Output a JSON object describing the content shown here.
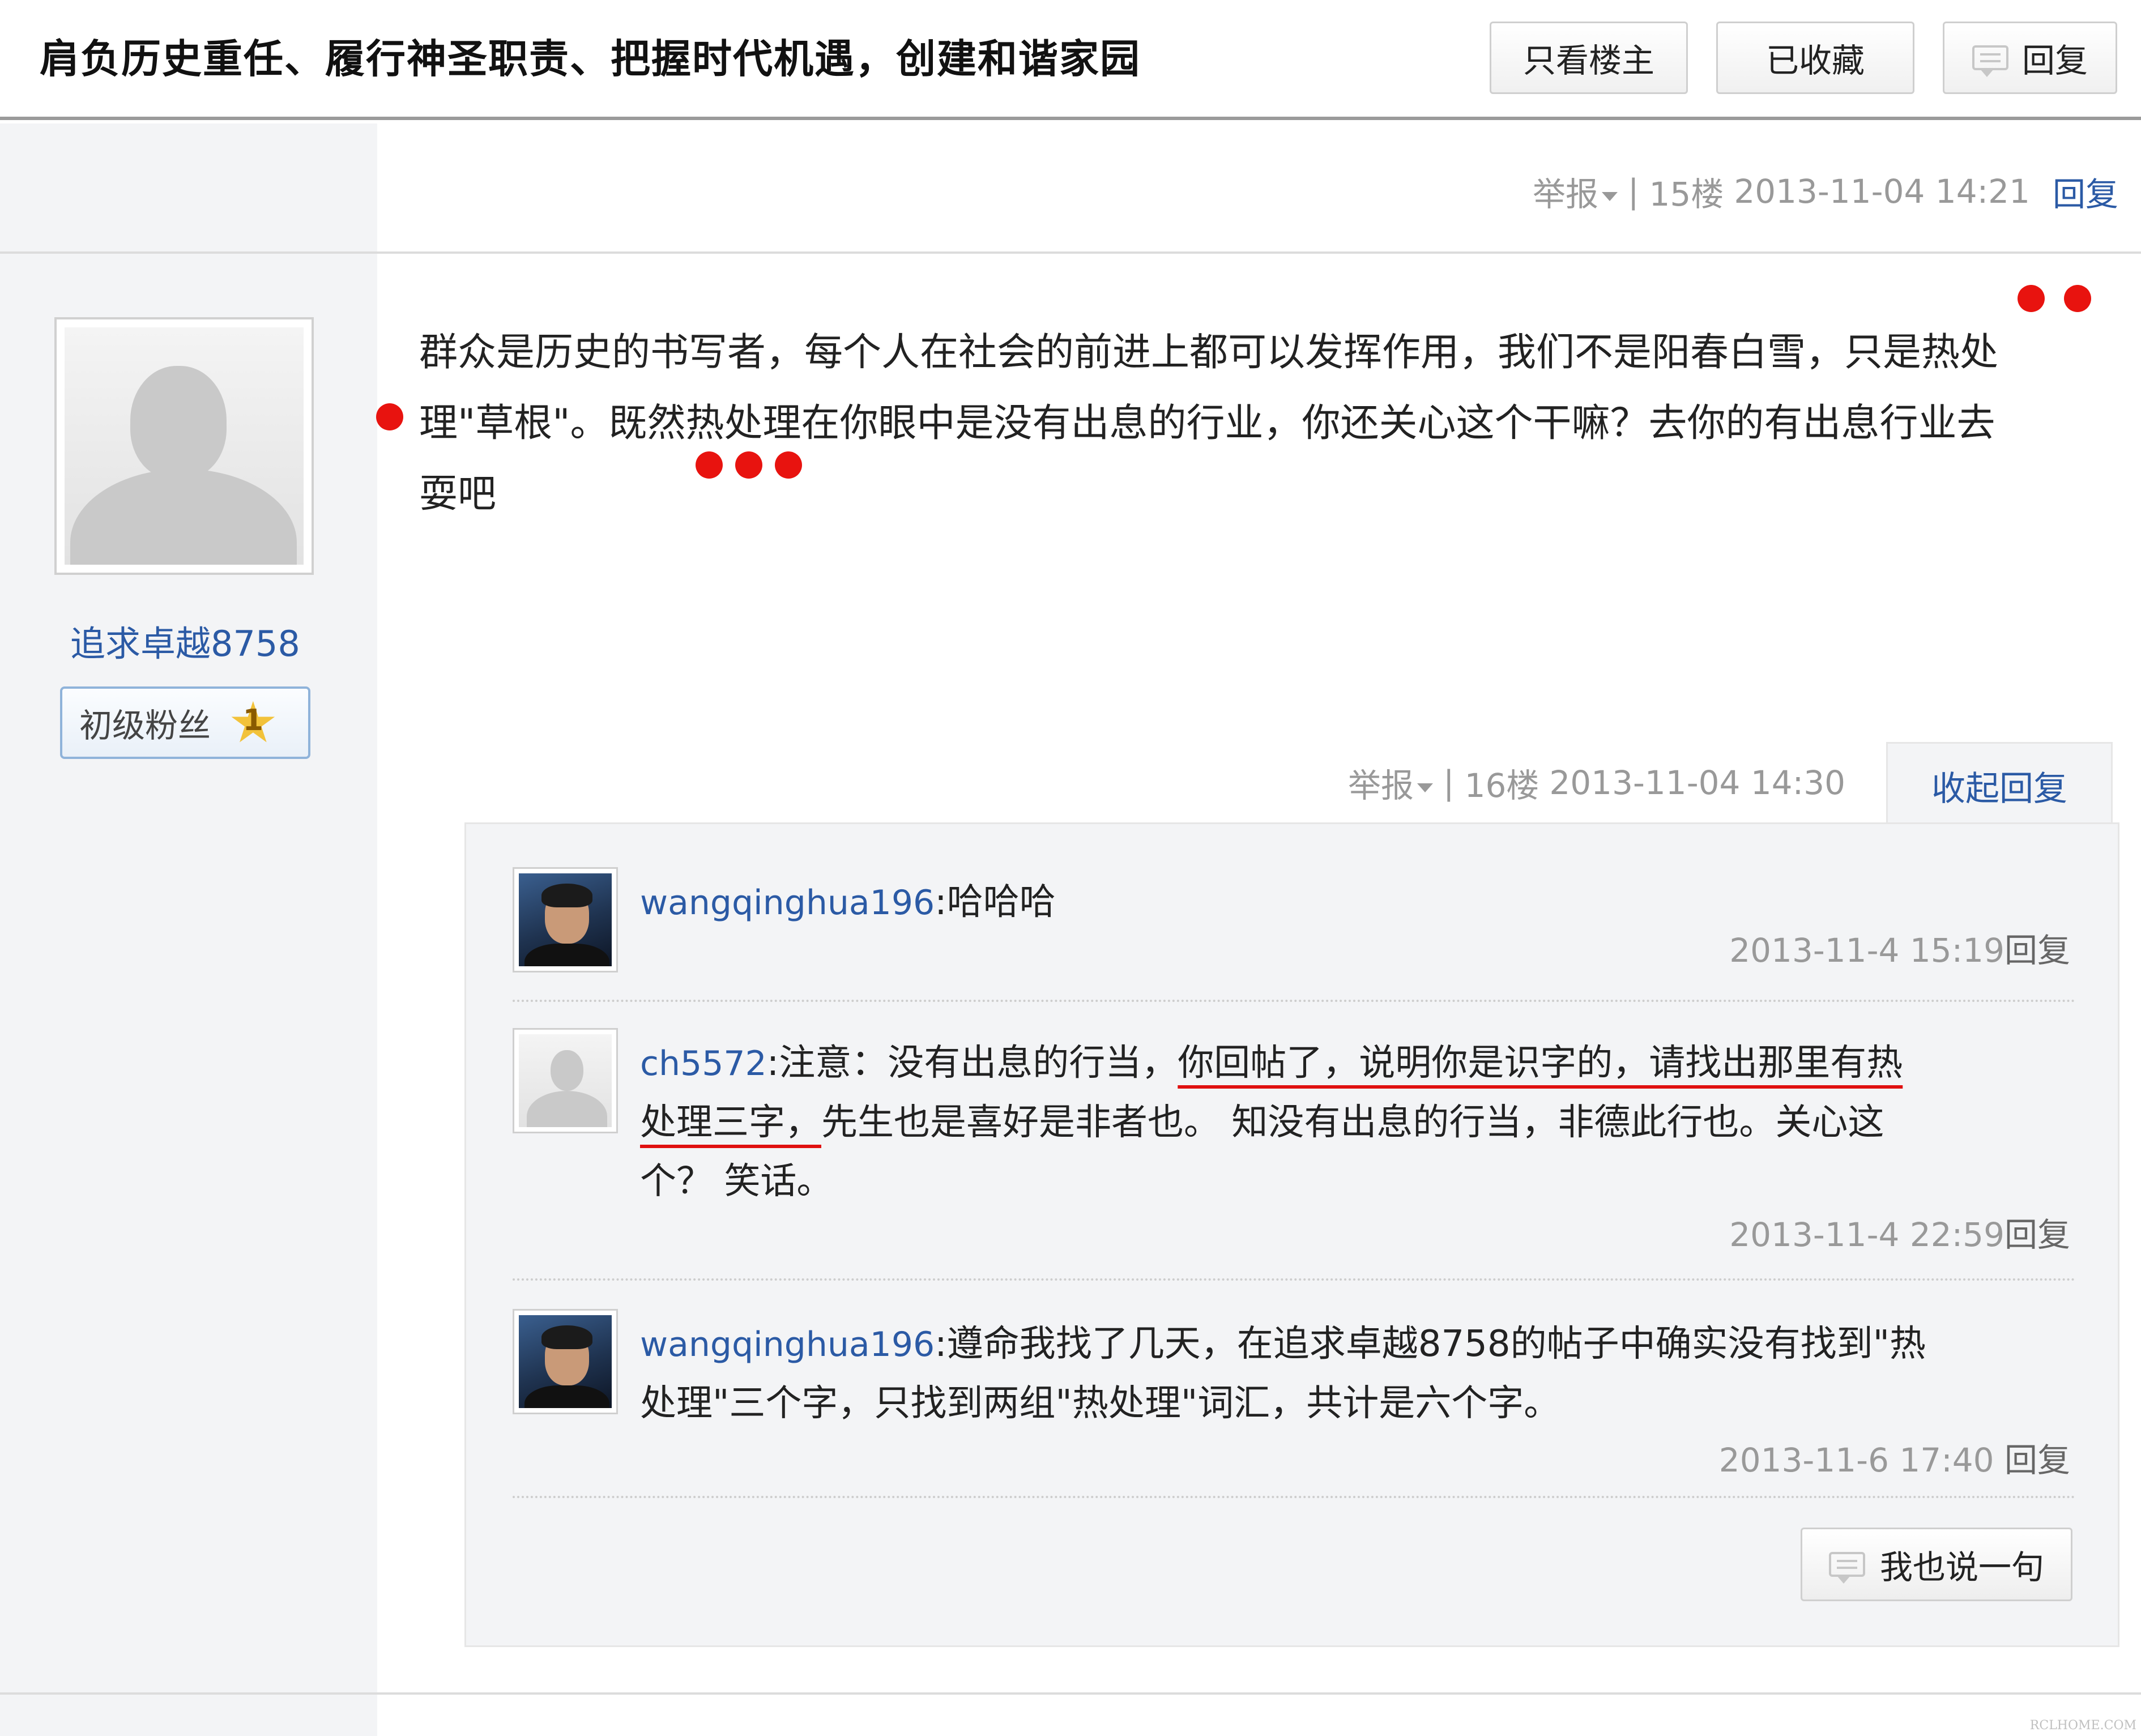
{
  "header": {
    "title": "肩负历史重任、履行神圣职责、把握时代机遇，创建和谐家园",
    "buttons": {
      "only_op": "只看楼主",
      "saved": "已收藏",
      "reply": "回复"
    }
  },
  "floor15": {
    "report": "举报",
    "sep": "|",
    "floor": "15楼",
    "time": "2013-11-04 14:21",
    "reply": "回复"
  },
  "author": {
    "username": "追求卓越8758",
    "badge": "初级粉丝",
    "level": "1"
  },
  "post": {
    "line1": "群众是历史的书写者，每个人在社会的前进上都可以发挥作用，我们不是阳春白雪，只是热处",
    "line2": "理\"草根\"。既然热处理在你眼中是没有出息的行业，你还关心这个干嘛？去你的有出息行业去",
    "line3": "耍吧"
  },
  "floor16": {
    "report": "举报",
    "sep": "|",
    "floor": "16楼",
    "time": "2013-11-04 14:30",
    "collapse": "收起回复"
  },
  "replies": [
    {
      "user": "wangqinghua196",
      "text": "哈哈哈",
      "time": "2013-11-4 15:19",
      "reply": "回复"
    },
    {
      "user": "ch5572",
      "text_a": "注意：没有出息的行当，",
      "text_b": "你回帖了，说明你是识字的，请找出那里有热",
      "text_c": "处理三字，",
      "text_d": "先生也是喜好是非者也。 知没有出息的行当，非德此行也。关心这",
      "text_e": "个？ 笑话。",
      "time": "2013-11-4 22:59",
      "reply": "回复"
    },
    {
      "user": "wangqinghua196",
      "text_a": "遵命我找了几天，在追求卓越8758的帖子中确实没有找到\"热",
      "text_b": "处理\"三个字，只找到两组\"热处理\"词汇，共计是六个字。",
      "time": "2013-11-6 17:40",
      "reply": "回复"
    }
  ],
  "say_button": "我也说一句",
  "watermark": "RCLHOME.COM",
  "colors": {
    "link": "#2b5aa5",
    "meta": "#999999",
    "annotation_red": "#e8130f",
    "sidebar_bg": "#f3f4f6"
  },
  "icons": {
    "reply_bubble": "speech-bubble-icon",
    "report_caret": "caret-down-icon",
    "level_star": "star-icon"
  }
}
